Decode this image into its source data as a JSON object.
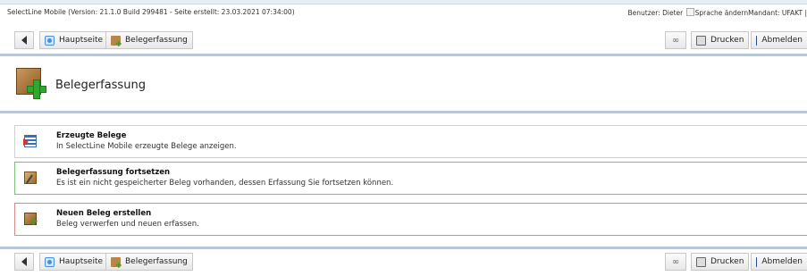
{
  "meta": {
    "left": "SelectLine Mobile (Version: 21.1.0 Build 299481 - Seite erstellt: 23.03.2021 07:34:00)",
    "user": "Benutzer: Dieter",
    "lang_alt": "Sprache ändern",
    "mandant": "Mandant: UFAKT |"
  },
  "toolbar": {
    "home_label": "Hauptseite",
    "beleg_label": "Belegerfassung",
    "print_label": "Drucken",
    "logout_label": "Abmelden"
  },
  "page": {
    "title": "Belegerfassung"
  },
  "cards": [
    {
      "title": "Erzeugte Belege",
      "desc": "In SelectLine Mobile erzeugte Belege anzeigen."
    },
    {
      "title": "Belegerfassung fortsetzen",
      "desc": "Es ist ein nicht gespeicherter Beleg vorhanden, dessen Erfassung Sie fortsetzen können."
    },
    {
      "title": "Neuen Beleg erstellen",
      "desc": "Beleg verwerfen und neuen erfassen."
    }
  ]
}
